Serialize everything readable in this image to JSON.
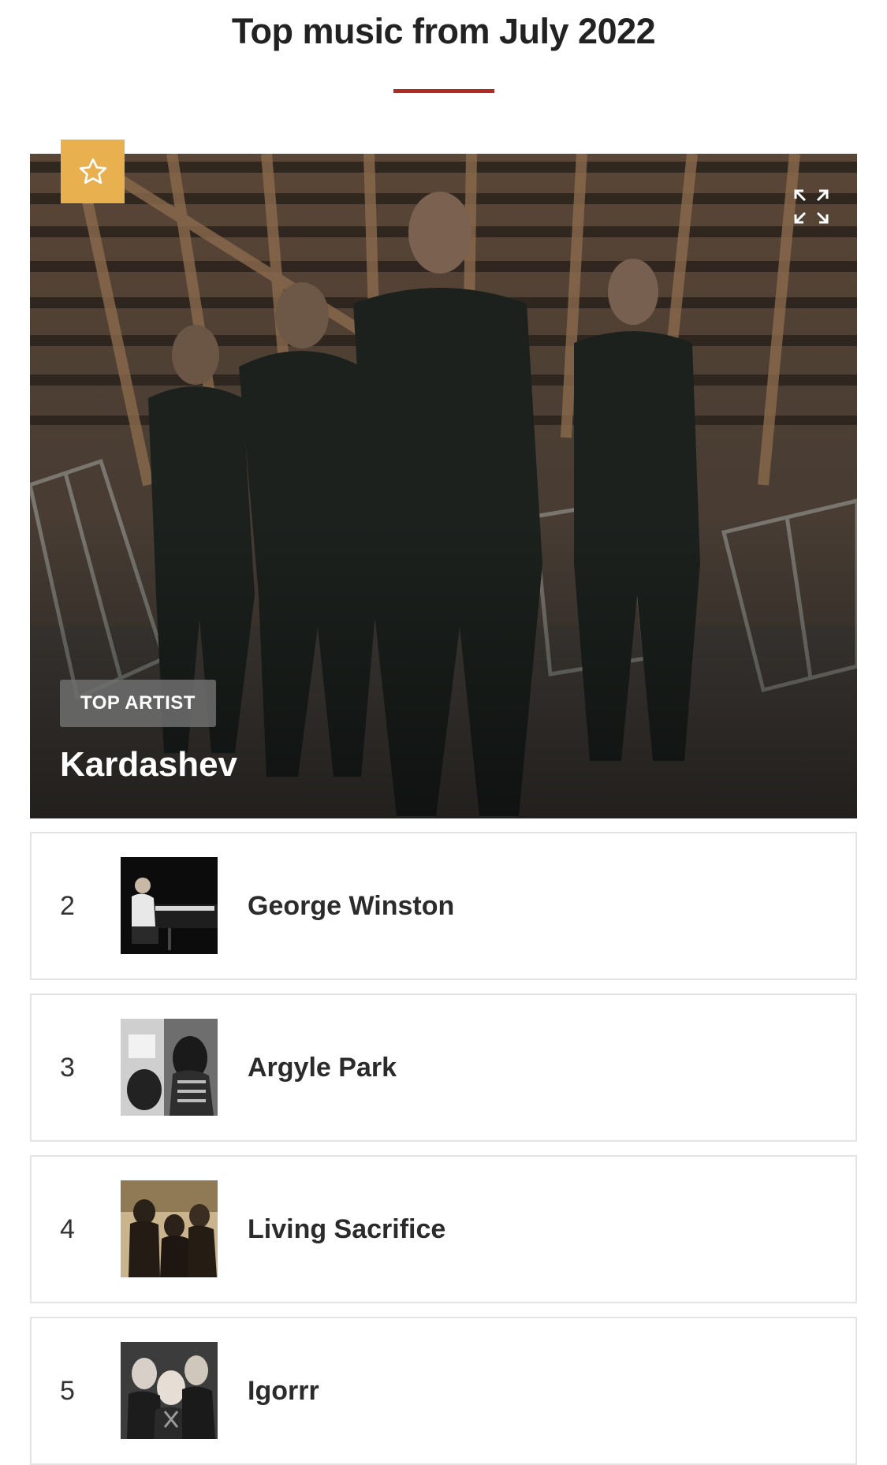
{
  "header": {
    "title": "Top music from July 2022"
  },
  "featured": {
    "badge": "TOP ARTIST",
    "name": "Kardashev",
    "icon": "expand-icon"
  },
  "list": [
    {
      "rank": "2",
      "name": "George Winston"
    },
    {
      "rank": "3",
      "name": "Argyle Park"
    },
    {
      "rank": "4",
      "name": "Living Sacrifice"
    },
    {
      "rank": "5",
      "name": "Igorrr"
    }
  ],
  "colors": {
    "accent": "#b32a22",
    "star_badge": "#e9b050",
    "border": "#e4e4e4"
  }
}
